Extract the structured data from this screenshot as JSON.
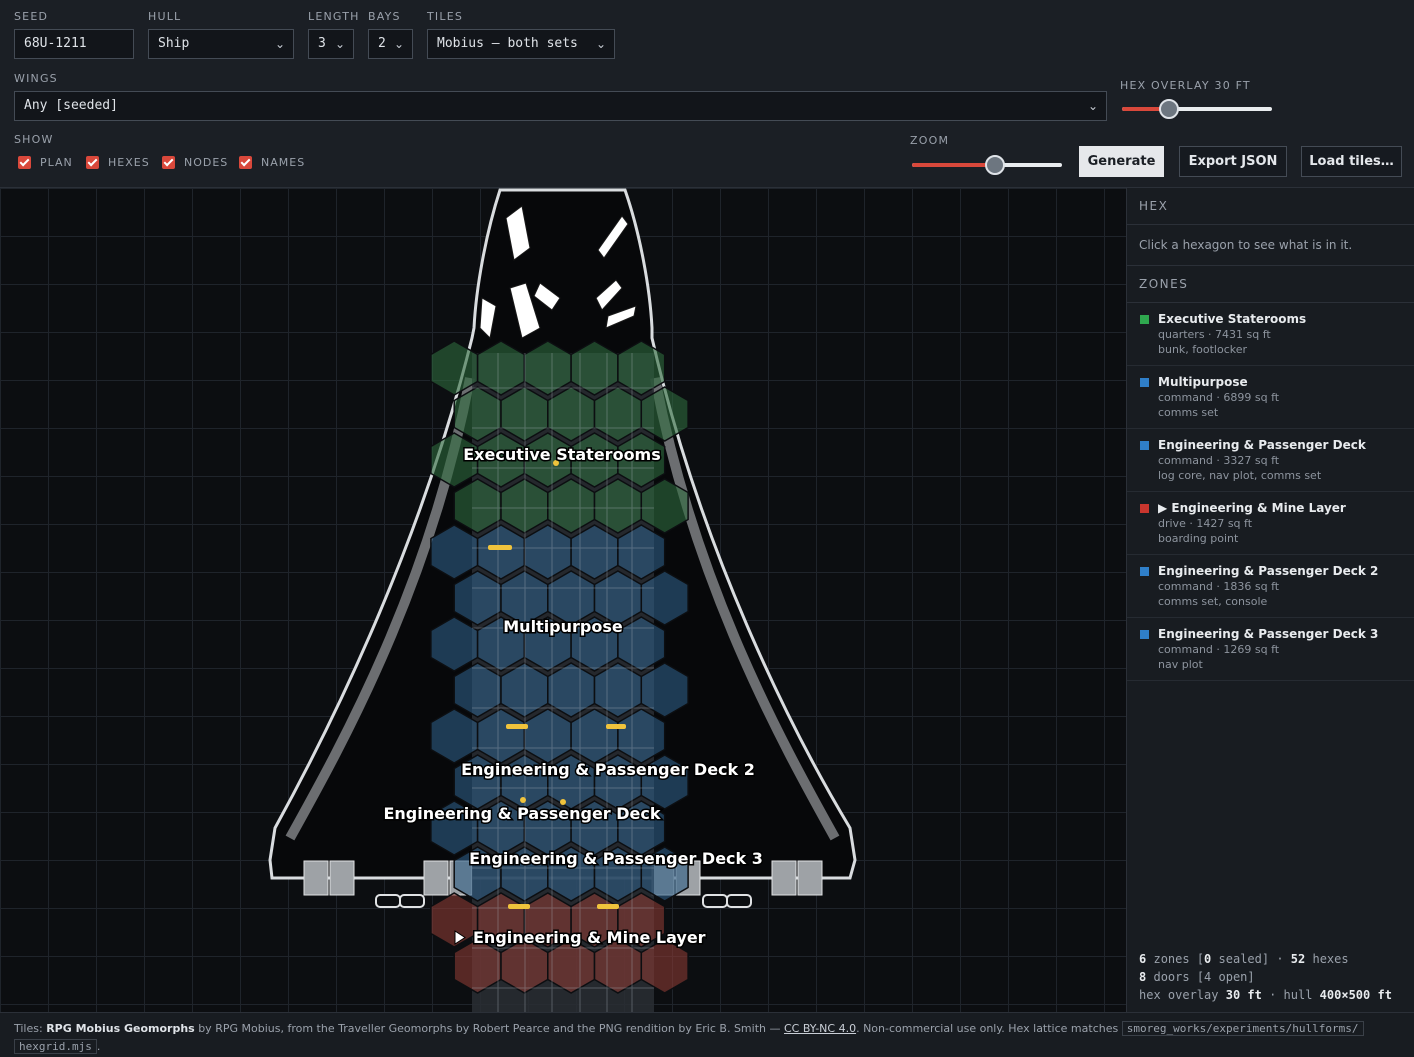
{
  "controls": {
    "seed": {
      "label": "SEED",
      "value": "68U-1211"
    },
    "hull": {
      "label": "HULL",
      "value": "Ship"
    },
    "length": {
      "label": "LENGTH",
      "value": "3"
    },
    "bays": {
      "label": "BAYS",
      "value": "2"
    },
    "tiles": {
      "label": "TILES",
      "value": "Mobius — both sets"
    },
    "wings": {
      "label": "WINGS",
      "value": "Any [seeded]"
    },
    "show": {
      "label": "SHOW",
      "options": [
        {
          "label": "PLAN",
          "checked": true
        },
        {
          "label": "HEXES",
          "checked": true
        },
        {
          "label": "NODES",
          "checked": true
        },
        {
          "label": "NAMES",
          "checked": true
        }
      ]
    },
    "hex_overlay": {
      "label": "HEX OVERLAY 30 FT",
      "level": 0.3
    },
    "zoom": {
      "label": "ZOOM",
      "level": 0.55
    },
    "buttons": {
      "generate": "Generate",
      "export": "Export JSON",
      "load": "Load tiles…"
    }
  },
  "map": {
    "labels": {
      "exec": "Executive Staterooms",
      "multi": "Multipurpose",
      "eng2": "Engineering & Passenger Deck 2",
      "eng1": "Engineering & Passenger Deck",
      "eng3": "Engineering & Passenger Deck 3",
      "mine": "Engineering & Mine Layer"
    }
  },
  "panel": {
    "hex_title": "HEX",
    "hex_hint": "Click a hexagon to see what is in it.",
    "zones_title": "ZONES",
    "zones": [
      {
        "name": "Executive Staterooms",
        "meta": "quarters · 7431 sq ft",
        "items": "bunk, footlocker",
        "color": "#2fa84f"
      },
      {
        "name": "Multipurpose",
        "meta": "command · 6899 sq ft",
        "items": "comms set",
        "color": "#2f7fc9"
      },
      {
        "name": "Engineering & Passenger Deck",
        "meta": "command · 3327 sq ft",
        "items": "log core, nav plot, comms set",
        "color": "#2f7fc9"
      },
      {
        "name": "▶ Engineering & Mine Layer",
        "meta": "drive · 1427 sq ft",
        "items": "boarding point",
        "color": "#c9362e"
      },
      {
        "name": "Engineering & Passenger Deck 2",
        "meta": "command · 1836 sq ft",
        "items": "comms set, console",
        "color": "#2f7fc9"
      },
      {
        "name": "Engineering & Passenger Deck 3",
        "meta": "command · 1269 sq ft",
        "items": "nav plot",
        "color": "#2f7fc9"
      }
    ],
    "stats": {
      "zones_count": "6",
      "zones_word": "zones [",
      "sealed_count": "0",
      "sealed_word": "sealed] ·",
      "hexes_count": "52",
      "hexes_word": "hexes",
      "doors_count": "8",
      "doors_word": "doors [4 open]",
      "overlay_label": "hex overlay",
      "overlay_value": "30 ft",
      "hull_label": "· hull",
      "hull_value": "400×500 ft"
    }
  },
  "footer": {
    "prefix": "Tiles:",
    "tileset": "RPG Mobius Geomorphs",
    "by": "by RPG Mobius, from the Traveller Geomorphs by Robert Pearce and the PNG rendition by Eric B. Smith —",
    "license": "CC BY-NC 4.0",
    "note": ". Non-commercial use only. Hex lattice matches",
    "path1": "smoreg_works/experiments/hullforms/",
    "path2": "hexgrid.mjs",
    "dot": "."
  }
}
